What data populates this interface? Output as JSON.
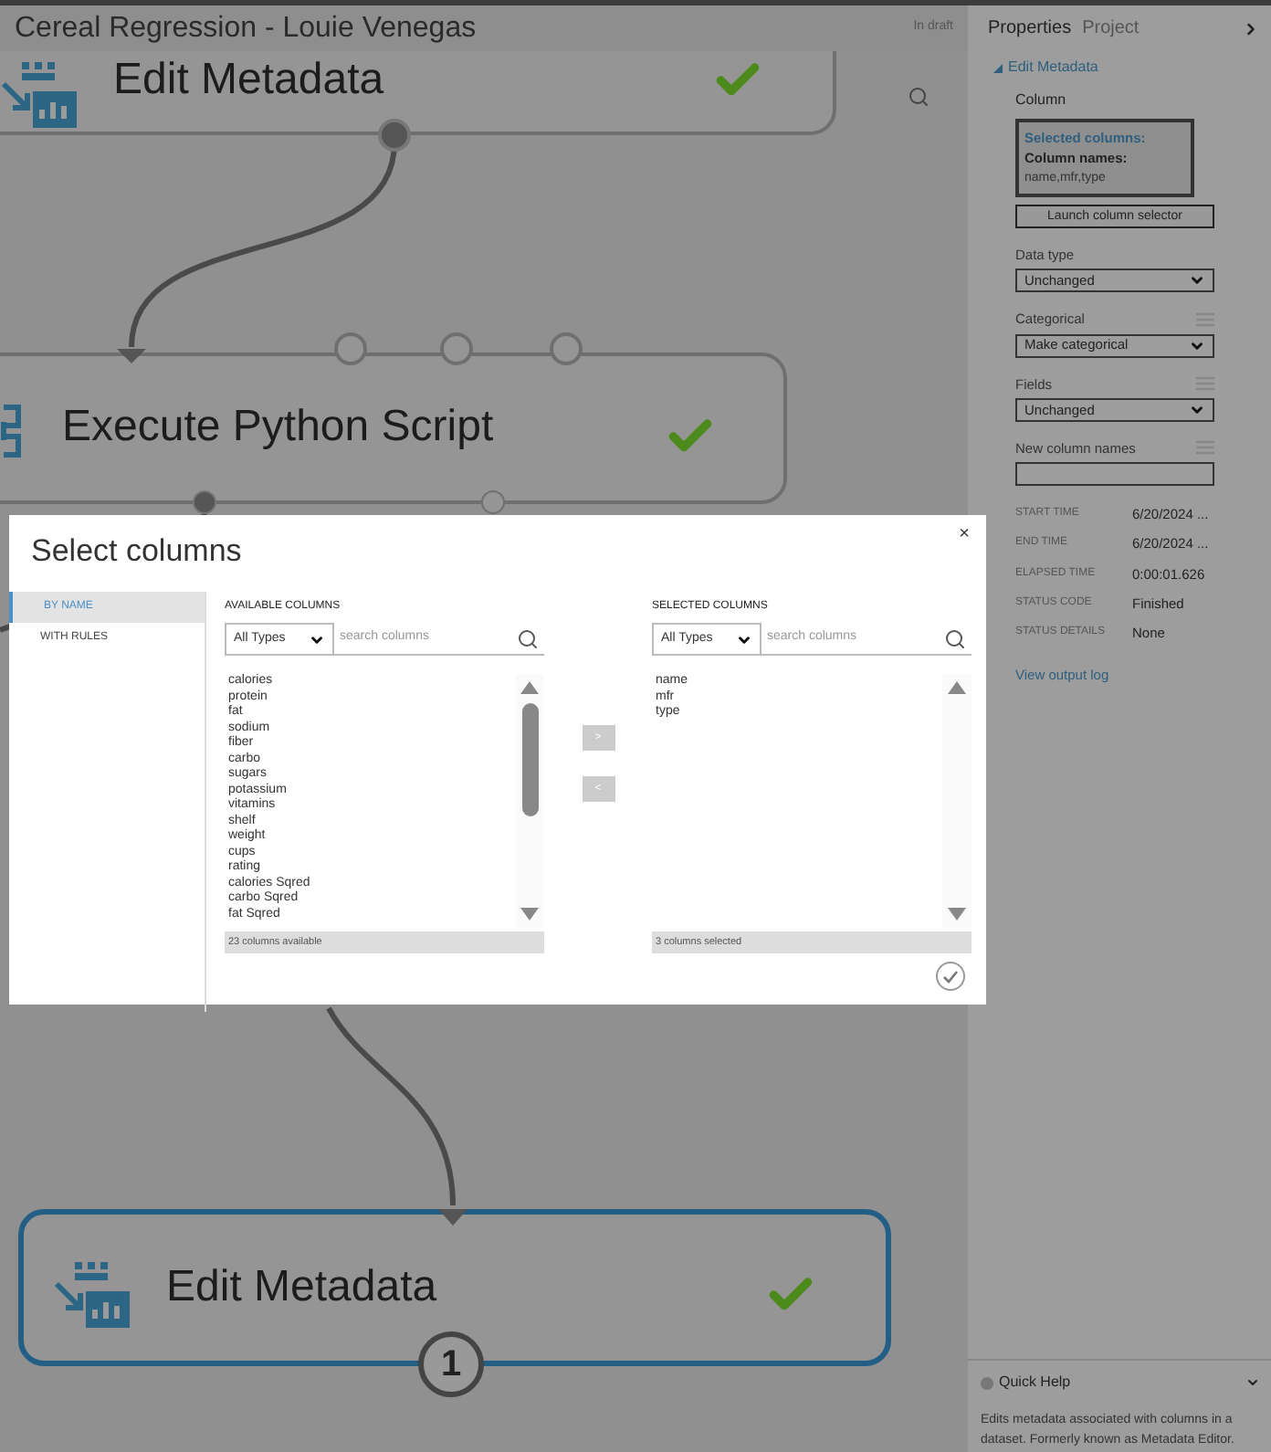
{
  "window": {
    "title": "Cereal Regression - Louie Venegas",
    "status": "In draft"
  },
  "canvas": {
    "nodes": [
      {
        "title": "Edit Metadata",
        "kind": "metadata",
        "done": true,
        "selected": false
      },
      {
        "title": "Execute Python Script",
        "kind": "python",
        "done": true,
        "selected": false
      },
      {
        "title": "Edit Metadata",
        "kind": "metadata",
        "done": true,
        "selected": true
      }
    ],
    "badge": "1"
  },
  "properties": {
    "tabs": [
      {
        "label": "Properties",
        "selected": true
      },
      {
        "label": "Project",
        "selected": false
      }
    ],
    "section": "Edit Metadata",
    "column_label": "Column",
    "column_box": {
      "heading": "Selected columns:",
      "subheading": "Column names:",
      "value": "name,mfr,type"
    },
    "launch_button": "Launch column selector",
    "fields": [
      {
        "label": "Data type",
        "kind": "select",
        "value": "Unchanged",
        "handle": false
      },
      {
        "label": "Categorical",
        "kind": "select",
        "value": "Make categorical",
        "handle": true
      },
      {
        "label": "Fields",
        "kind": "select",
        "value": "Unchanged",
        "handle": true
      },
      {
        "label": "New column names",
        "kind": "text",
        "handle": true
      }
    ],
    "stats": [
      {
        "label": "START TIME",
        "value": "6/20/2024 ..."
      },
      {
        "label": "END TIME",
        "value": "6/20/2024 ..."
      },
      {
        "label": "ELAPSED TIME",
        "value": "0:00:01.626"
      },
      {
        "label": "STATUS CODE",
        "value": "Finished"
      },
      {
        "label": "STATUS DETAILS",
        "value": "None"
      }
    ],
    "link": "View output log"
  },
  "quick_help": {
    "title": "Quick Help",
    "text": "Edits metadata associated with columns in a dataset. Formerly known as Metadata Editor."
  },
  "dialog": {
    "title": "Select columns",
    "close": "×",
    "nav": [
      {
        "label": "BY NAME",
        "selected": true
      },
      {
        "label": "WITH RULES",
        "selected": false
      }
    ],
    "available": {
      "heading": "AVAILABLE COLUMNS",
      "filter": "All Types",
      "placeholder": "search columns",
      "items": [
        "calories",
        "protein",
        "fat",
        "sodium",
        "fiber",
        "carbo",
        "sugars",
        "potassium",
        "vitamins",
        "shelf",
        "weight",
        "cups",
        "rating",
        "calories Sqred",
        "carbo Sqred",
        "fat Sqred"
      ],
      "footer": "23 columns available"
    },
    "add": ">",
    "remove": "<",
    "selected": {
      "heading": "SELECTED COLUMNS",
      "filter": "All Types",
      "placeholder": "search columns",
      "items": [
        "name",
        "mfr",
        "type"
      ],
      "footer": "3 columns selected"
    }
  }
}
